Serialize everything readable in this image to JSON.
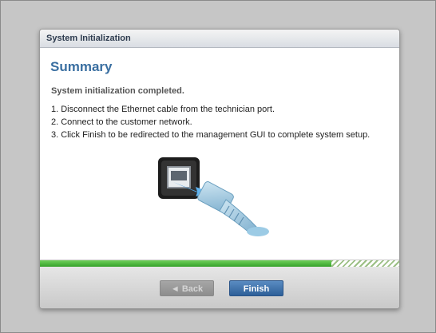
{
  "dialog": {
    "title": "System Initialization",
    "heading": "Summary",
    "status": "System initialization completed.",
    "steps": [
      "1. Disconnect the Ethernet cable from the technician port.",
      "2. Connect to the customer network.",
      "3. Click Finish to be redirected to the management GUI to complete system setup."
    ],
    "illustration_icon": "ethernet-cable-port-icon",
    "progress": 0.81
  },
  "buttons": {
    "back_label": "◄ Back",
    "finish_label": "Finish"
  },
  "colors": {
    "heading": "#3a6fa1",
    "progress": "#44b334",
    "finish": "#3a6fa8"
  }
}
